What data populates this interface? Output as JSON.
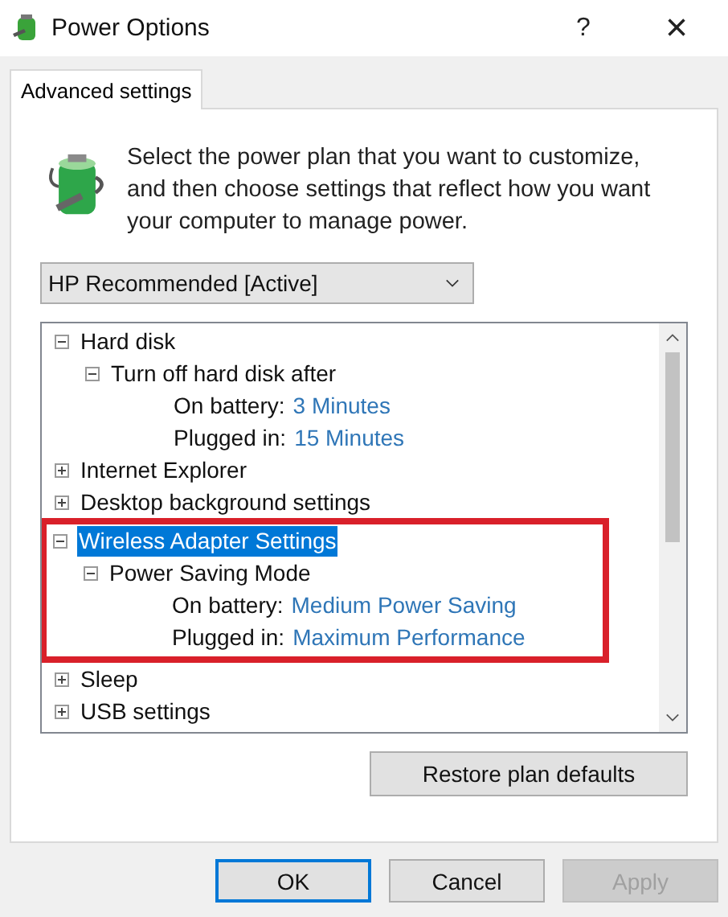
{
  "window": {
    "title": "Power Options",
    "help": "?",
    "close": "×"
  },
  "tabs": [
    {
      "label": "Advanced settings",
      "selected": true
    }
  ],
  "description": "Select the power plan that you want to customize, and then choose settings that reflect how you want your computer to manage power.",
  "plan_dropdown": {
    "value": "HP Recommended [Active]"
  },
  "tree": [
    {
      "label": "Hard disk",
      "expanded": true,
      "selected": false,
      "children": [
        {
          "label": "Turn off hard disk after",
          "expanded": true,
          "selected": false,
          "children": [
            {
              "label": "On battery:",
              "value": "3 Minutes"
            },
            {
              "label": "Plugged in:",
              "value": "15 Minutes"
            }
          ]
        }
      ]
    },
    {
      "label": "Internet Explorer",
      "expanded": false,
      "selected": false
    },
    {
      "label": "Desktop background settings",
      "expanded": false,
      "selected": false
    },
    {
      "label": "Wireless Adapter Settings",
      "expanded": true,
      "selected": true,
      "highlighted": true,
      "children": [
        {
          "label": "Power Saving Mode",
          "expanded": true,
          "selected": false,
          "children": [
            {
              "label": "On battery:",
              "value": "Medium Power Saving"
            },
            {
              "label": "Plugged in:",
              "value": "Maximum Performance"
            }
          ]
        }
      ]
    },
    {
      "label": "Sleep",
      "expanded": false,
      "selected": false
    },
    {
      "label": "USB settings",
      "expanded": false,
      "selected": false
    }
  ],
  "restore_button": "Restore plan defaults",
  "buttons": [
    {
      "label": "OK",
      "default": true,
      "disabled": false
    },
    {
      "label": "Cancel",
      "default": false,
      "disabled": false
    },
    {
      "label": "Apply",
      "default": false,
      "disabled": true
    }
  ]
}
